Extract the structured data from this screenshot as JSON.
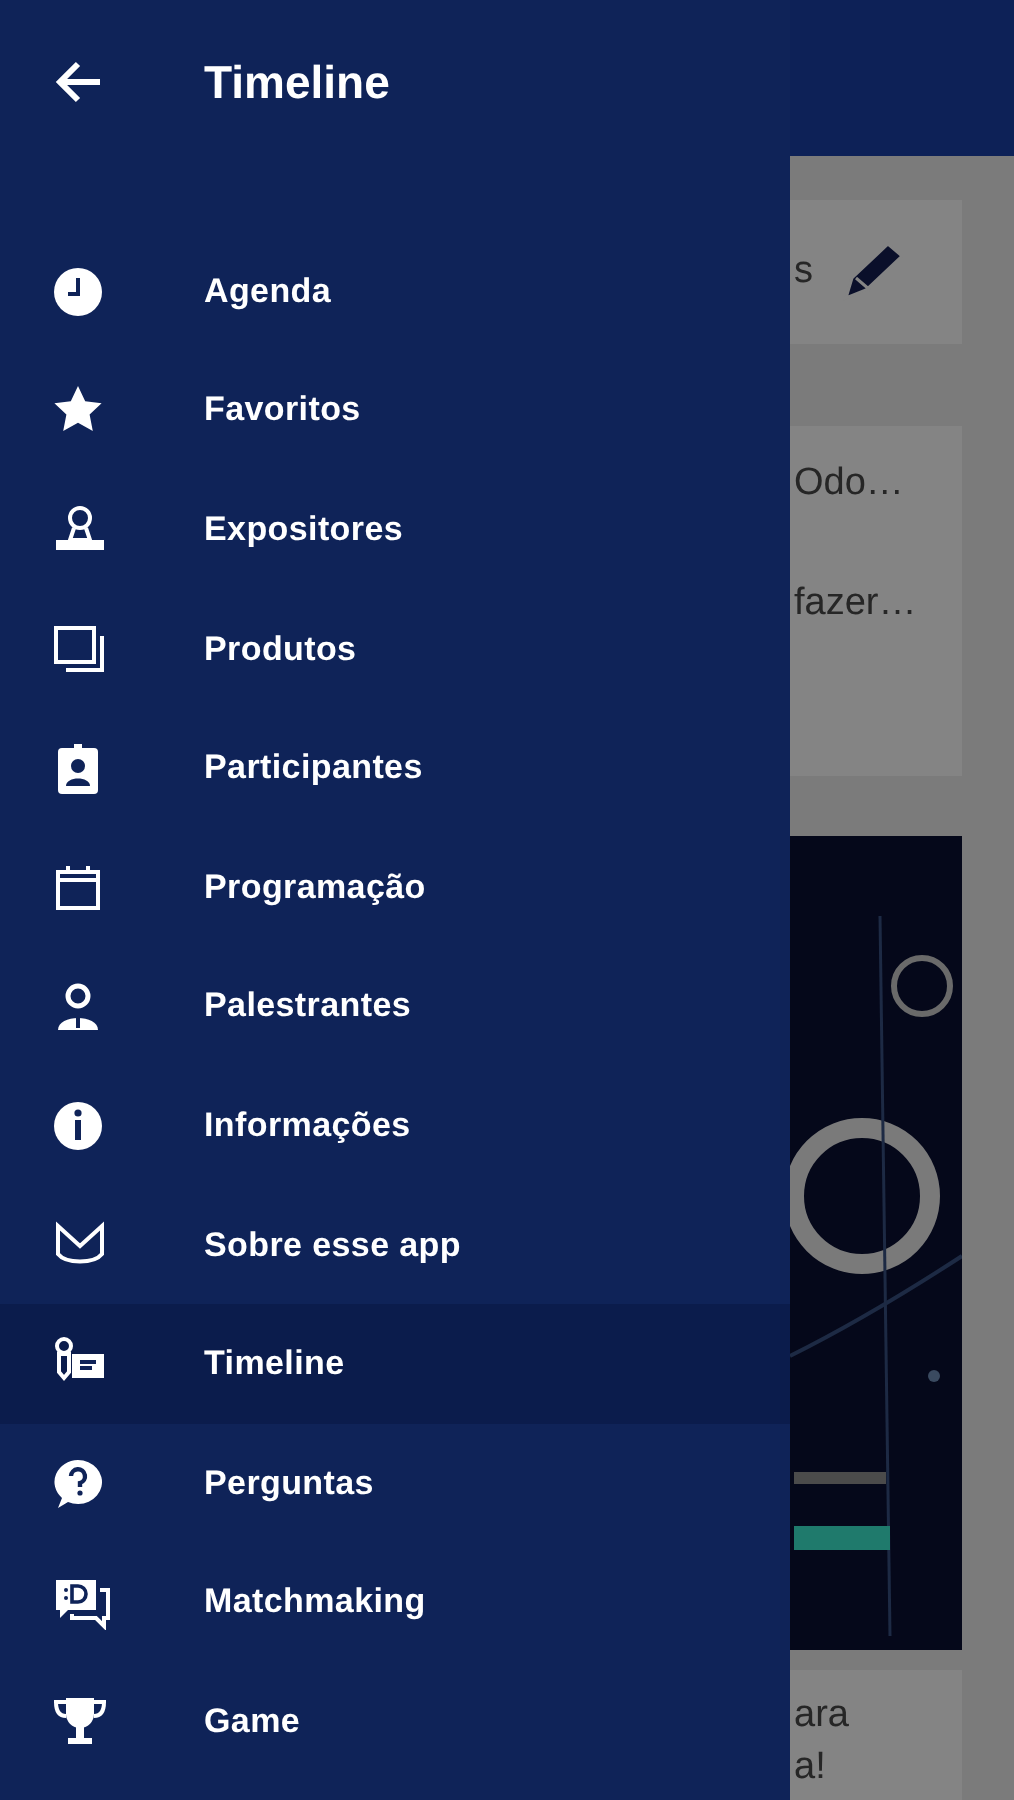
{
  "drawer": {
    "title": "Timeline",
    "items": [
      {
        "label": "Agenda",
        "selected": false
      },
      {
        "label": "Favoritos",
        "selected": false
      },
      {
        "label": "Expositores",
        "selected": false
      },
      {
        "label": "Produtos",
        "selected": false
      },
      {
        "label": "Participantes",
        "selected": false
      },
      {
        "label": "Programação",
        "selected": false
      },
      {
        "label": "Palestrantes",
        "selected": false
      },
      {
        "label": "Informações",
        "selected": false
      },
      {
        "label": "Sobre esse app",
        "selected": false
      },
      {
        "label": "Timeline",
        "selected": true
      },
      {
        "label": "Perguntas",
        "selected": false
      },
      {
        "label": "Matchmaking",
        "selected": false
      },
      {
        "label": "Game",
        "selected": false
      }
    ]
  },
  "background": {
    "post_box": {
      "text": "s"
    },
    "post": {
      "title": "Odo…",
      "body": "fazer…"
    },
    "next_post": {
      "text": "ara\na!"
    }
  }
}
